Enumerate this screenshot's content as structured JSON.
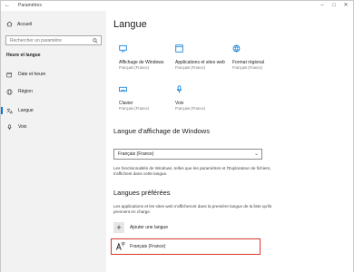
{
  "window": {
    "title": "Paramètres"
  },
  "sidebar": {
    "home_label": "Accueil",
    "search_placeholder": "Rechercher un paramètre",
    "section_title": "Heure et langue",
    "items": [
      {
        "label": "Date et heure",
        "icon": "calendar-clock-icon"
      },
      {
        "label": "Région",
        "icon": "globe-icon"
      },
      {
        "label": "Langue",
        "icon": "language-icon",
        "active": true
      },
      {
        "label": "Voix",
        "icon": "microphone-icon"
      }
    ]
  },
  "main": {
    "title": "Langue",
    "tiles": [
      {
        "label": "Affichage de Windows",
        "sub": "Français (France)",
        "icon": "display-icon"
      },
      {
        "label": "Applications et sites web",
        "sub": "Français (France)",
        "icon": "apps-icon"
      },
      {
        "label": "Format régional",
        "sub": "Français (France)",
        "icon": "globe-format-icon"
      },
      {
        "label": "Clavier",
        "sub": "Français (France)",
        "icon": "keyboard-icon"
      },
      {
        "label": "Voix",
        "sub": "Français (France)",
        "icon": "microphone-icon"
      }
    ],
    "display_lang_title": "Langue d'affichage de Windows",
    "display_lang_value": "Français (France)",
    "display_lang_desc": "Les fonctionnalités de Windows, telles que les paramètres et l'Explorateur de fichiers, s'affichent dans cette langue.",
    "preferred_title": "Langues préférées",
    "preferred_desc": "Les applications et les sites web s'afficheront dans la première langue de la liste qu'ils prennent en charge.",
    "add_lang_label": "Ajouter une langue",
    "lang_row_name": "Français (France)",
    "accent_color": "#0078d7",
    "highlight_color": "#d9362c"
  }
}
